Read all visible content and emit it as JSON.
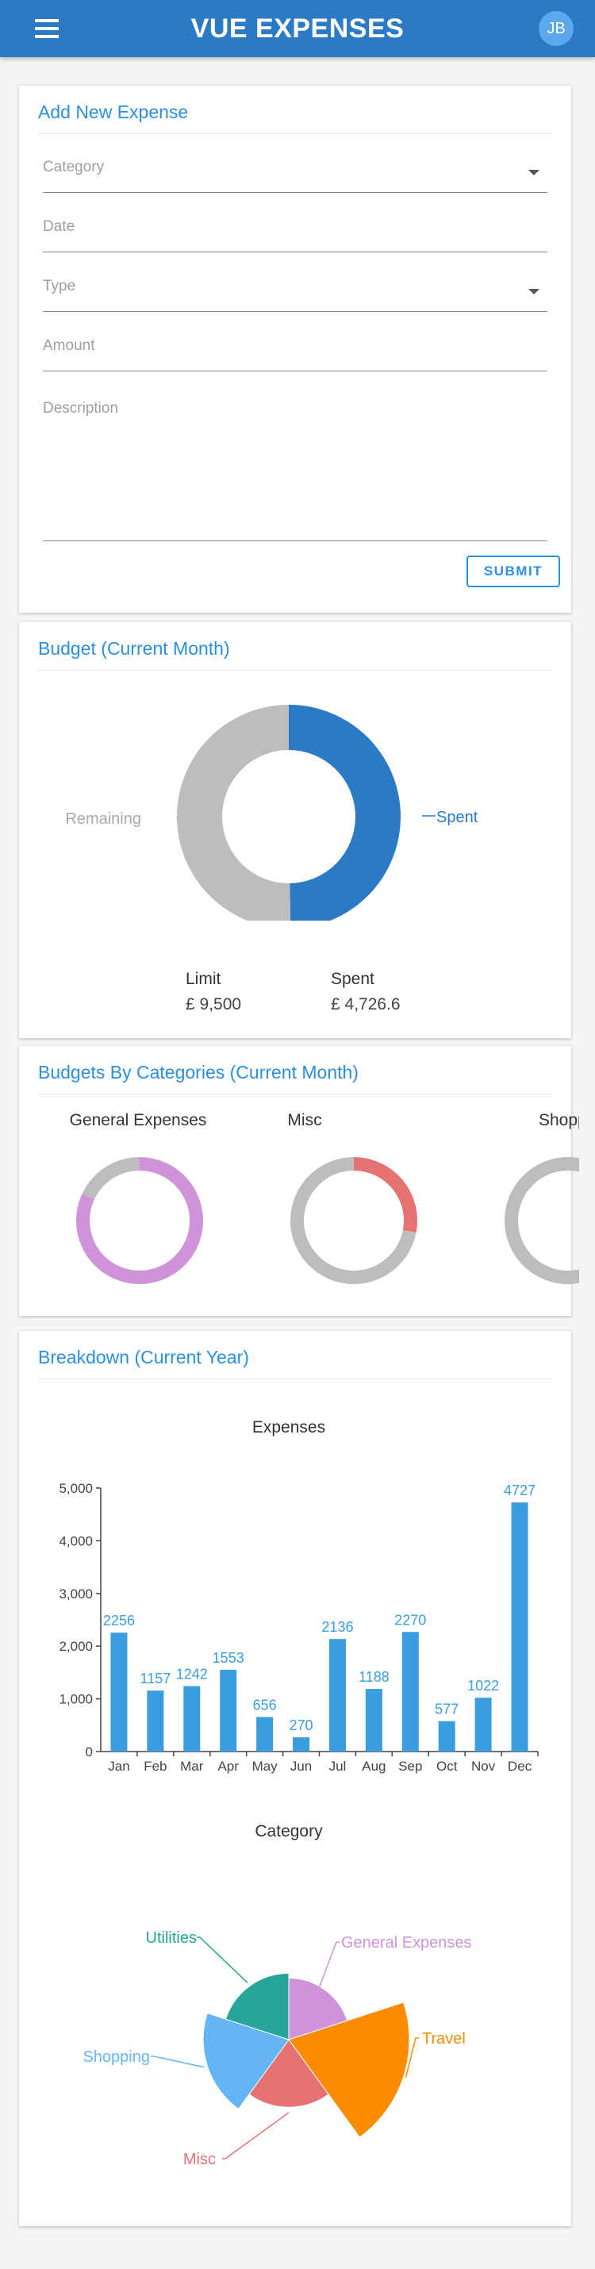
{
  "app": {
    "title": "VUE EXPENSES",
    "avatar_initials": "JB",
    "menu_icon": "hamburger-menu-icon",
    "primary_color": "#2a7ac6",
    "accent_color": "#2b8fde"
  },
  "expense_form": {
    "title": "Add New Expense",
    "category_label": "Category",
    "date_label": "Date",
    "type_label": "Type",
    "amount_label": "Amount",
    "description_label": "Description",
    "submit_label": "SUBMIT"
  },
  "budget": {
    "title": "Budget (Current Month)",
    "remaining_label": "Remaining",
    "spent_label": "Spent",
    "limit_caption": "Limit",
    "limit_value": "£ 9,500",
    "spent_caption": "Spent",
    "spent_value": "£ 4,726.6",
    "spent_fraction": 0.4975,
    "spent_color": "#2a7ac6",
    "remaining_color": "#bdbdbd"
  },
  "categories_budget": {
    "title": "Budgets By Categories (Current Month)",
    "items": [
      {
        "name": "General Expenses",
        "spent_fraction": 0.82,
        "color": "#ce93d8"
      },
      {
        "name": "Misc",
        "spent_fraction": 0.28,
        "color": "#e57373"
      },
      {
        "name": "Shopping",
        "spent_fraction": 0.0,
        "color": "#64b5f6"
      }
    ]
  },
  "breakdown": {
    "title": "Breakdown (Current Year)"
  },
  "chart_data": [
    {
      "type": "bar",
      "title": "Expenses",
      "categories": [
        "Jan",
        "Feb",
        "Mar",
        "Apr",
        "May",
        "Jun",
        "Jul",
        "Aug",
        "Sep",
        "Oct",
        "Nov",
        "Dec"
      ],
      "values": [
        2256,
        1157,
        1242,
        1553,
        656,
        270,
        2136,
        1188,
        2270,
        577,
        1022,
        4727
      ],
      "data_labels": [
        "2256",
        "1157",
        "1242",
        "1553",
        "656",
        "270",
        "2136",
        "1188",
        "2270",
        "577",
        "1022",
        "4727"
      ],
      "ylim": [
        0,
        5000
      ],
      "yticks": [
        0,
        1000,
        2000,
        3000,
        4000,
        5000
      ],
      "ytick_labels": [
        "0",
        "1,000",
        "2,000",
        "3,000",
        "4,000",
        "5,000"
      ],
      "color": "#3a9de0",
      "grid": false
    },
    {
      "type": "pie",
      "title": "Category",
      "style": "polar-area",
      "slices": [
        {
          "label": "General Expenses",
          "angle_fraction": 0.2,
          "radius_fraction": 0.51,
          "color": "#ce93d8"
        },
        {
          "label": "Travel",
          "angle_fraction": 0.2,
          "radius_fraction": 1.0,
          "color": "#fb8c00"
        },
        {
          "label": "Misc",
          "angle_fraction": 0.2,
          "radius_fraction": 0.56,
          "color": "#e57373"
        },
        {
          "label": "Shopping",
          "angle_fraction": 0.2,
          "radius_fraction": 0.71,
          "color": "#64b5f6"
        },
        {
          "label": "Utilities",
          "angle_fraction": 0.2,
          "radius_fraction": 0.55,
          "color": "#26a69a"
        }
      ]
    }
  ]
}
